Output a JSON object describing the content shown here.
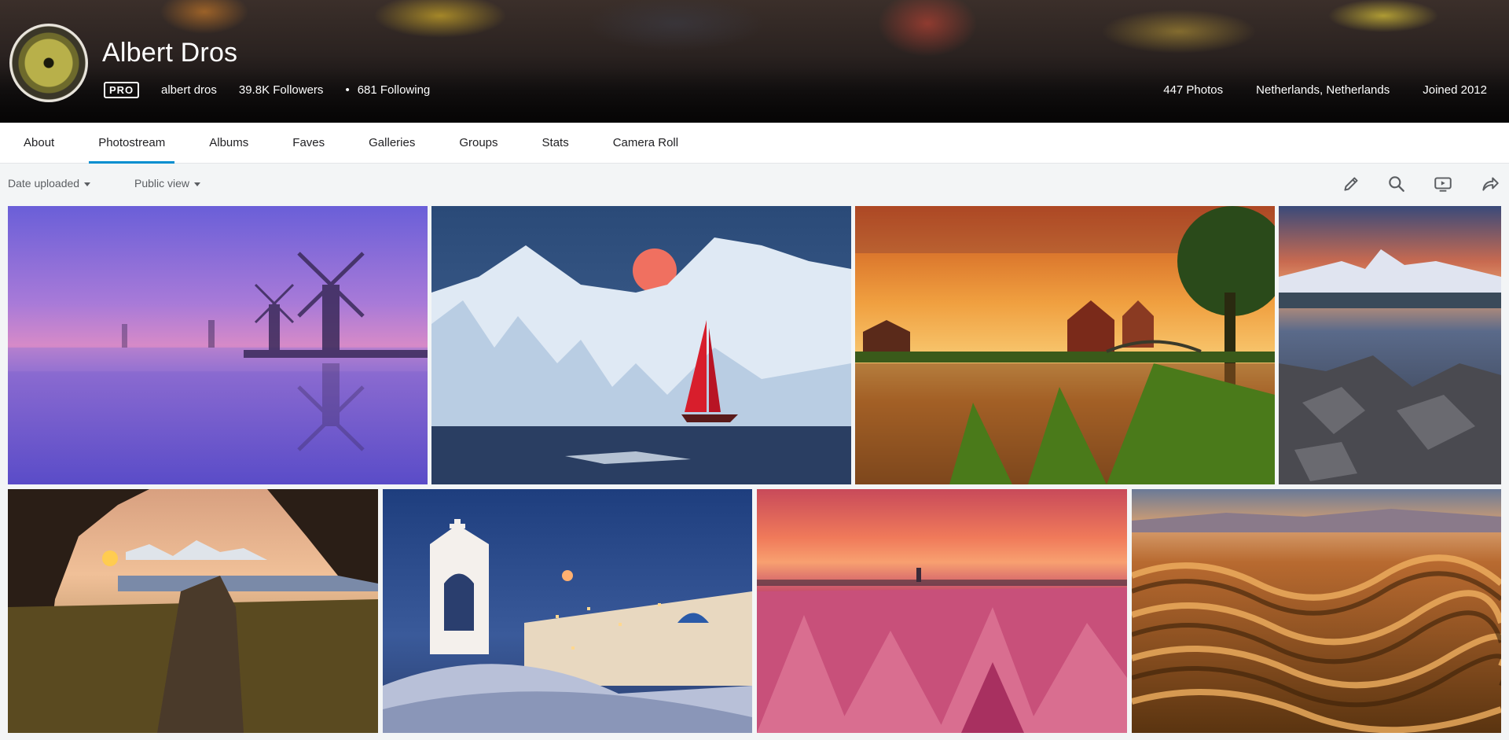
{
  "profile": {
    "name": "Albert Dros",
    "badge": "PRO",
    "username": "albert dros",
    "followers": "39.8K Followers",
    "following": "681 Following",
    "photos": "447 Photos",
    "location": "Netherlands, Netherlands",
    "joined": "Joined 2012"
  },
  "tabs": [
    {
      "label": "About"
    },
    {
      "label": "Photostream",
      "active": true
    },
    {
      "label": "Albums"
    },
    {
      "label": "Faves"
    },
    {
      "label": "Galleries"
    },
    {
      "label": "Groups"
    },
    {
      "label": "Stats"
    },
    {
      "label": "Camera Roll"
    }
  ],
  "toolbar": {
    "sort_label": "Date uploaded",
    "view_label": "Public view",
    "icons": [
      "pencil-icon",
      "search-icon",
      "slideshow-icon",
      "share-icon"
    ]
  },
  "colors": {
    "accent": "#008ecf",
    "text": "#212124",
    "muted": "#5b5e62"
  }
}
